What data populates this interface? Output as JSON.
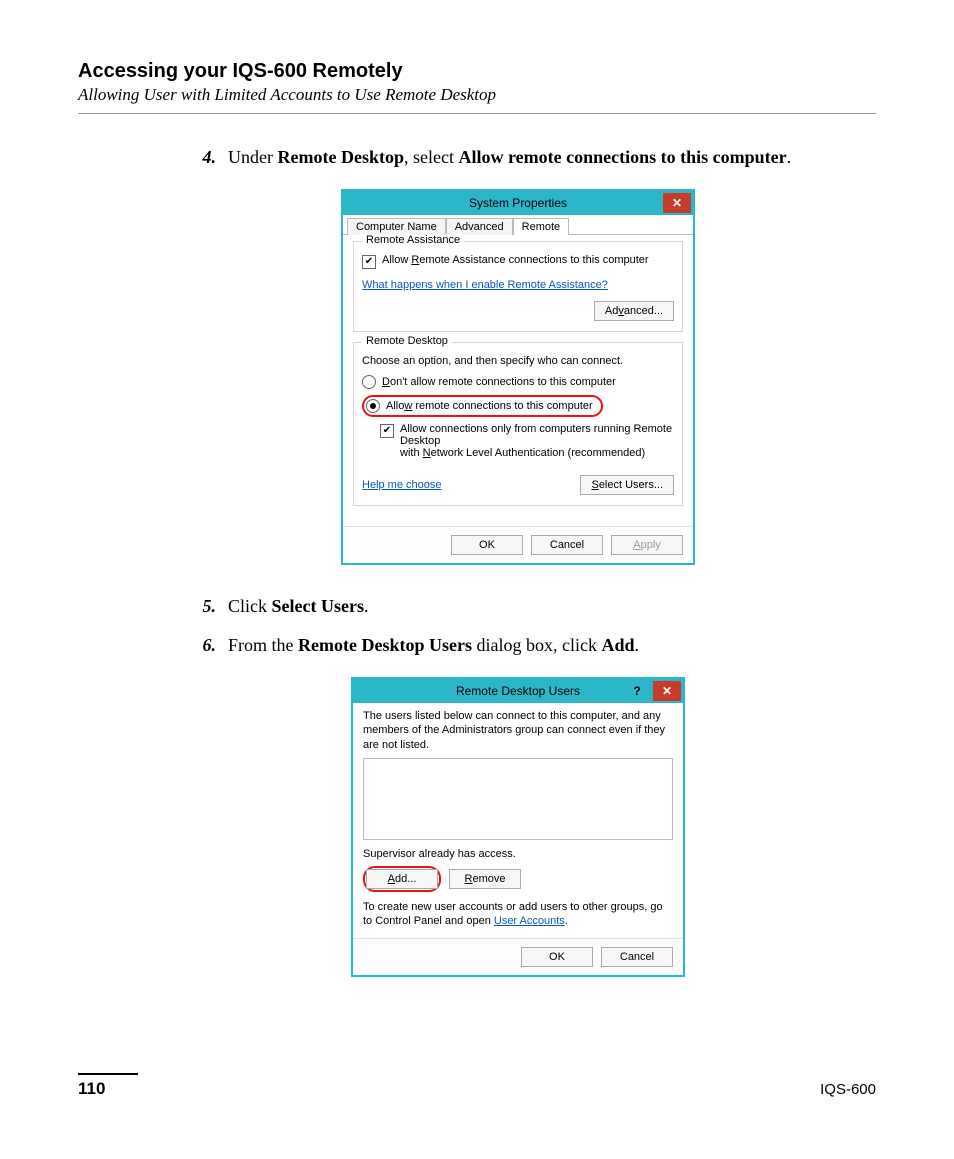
{
  "header": {
    "title": "Accessing your IQS-600 Remotely",
    "subtitle": "Allowing User with Limited Accounts to Use Remote Desktop"
  },
  "steps": {
    "s4": {
      "num": "4.",
      "pre": "Under ",
      "b1": "Remote Desktop",
      "mid": ", select ",
      "b2": "Allow remote connections to this computer",
      "post": "."
    },
    "s5": {
      "num": "5.",
      "pre": "Click ",
      "b1": "Select Users",
      "post": "."
    },
    "s6": {
      "num": "6.",
      "pre": "From the ",
      "b1": "Remote Desktop Users",
      "mid": " dialog box, click ",
      "b2": "Add",
      "post": "."
    }
  },
  "dlg1": {
    "title": "System Properties",
    "close": "✕",
    "tabs": {
      "t0": "Computer Name",
      "t1": "Advanced",
      "t2": "Remote"
    },
    "ra": {
      "title": "Remote Assistance",
      "chk_pre": "Allow ",
      "chk_u": "R",
      "chk_post": "emote Assistance connections to this computer",
      "link": "What happens when I enable Remote Assistance?",
      "adv_pre": "Ad",
      "adv_u": "v",
      "adv_post": "anced..."
    },
    "rd": {
      "title": "Remote Desktop",
      "choose": "Choose an option, and then specify who can connect.",
      "opt1_u": "D",
      "opt1_post": "on't allow remote connections to this computer",
      "opt2_pre": "Allo",
      "opt2_u": "w",
      "opt2_post": " remote connections to this computer",
      "nla_line1": "Allow connections only from computers running Remote Desktop",
      "nla_line2_pre": "with ",
      "nla_u": "N",
      "nla_line2_post": "etwork Level Authentication (recommended)",
      "help": "Help me choose",
      "select_u": "S",
      "select_post": "elect Users..."
    },
    "footer": {
      "ok": "OK",
      "cancel": "Cancel",
      "apply_u": "A",
      "apply_post": "pply"
    }
  },
  "dlg2": {
    "title": "Remote Desktop Users",
    "help": "?",
    "close": "✕",
    "desc": "The users listed below can connect to this computer, and any members of the Administrators group can connect even if they are not listed.",
    "access": "Supervisor already has access.",
    "add_u": "A",
    "add_post": "dd...",
    "remove_u": "R",
    "remove_post": "emove",
    "note_pre": "To create new user accounts or add users to other groups, go to Control Panel and open ",
    "note_link": "User Accounts",
    "note_post": ".",
    "ok": "OK",
    "cancel": "Cancel"
  },
  "footer": {
    "page": "110",
    "model": "IQS-600"
  }
}
